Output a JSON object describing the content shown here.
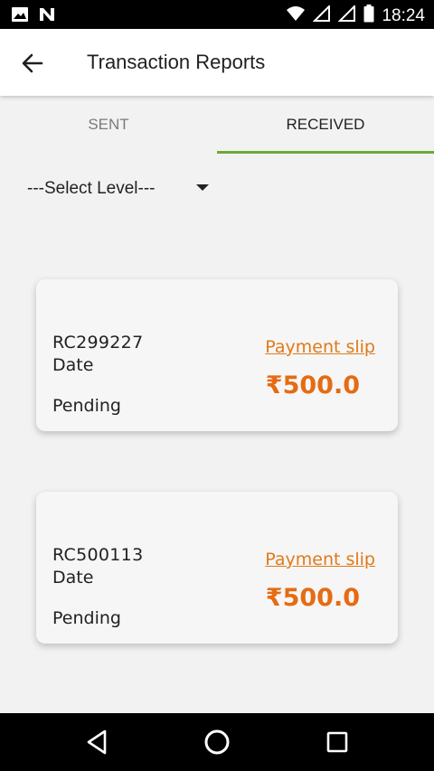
{
  "status_bar": {
    "time": "18:24",
    "icons": [
      "image-icon",
      "n-icon",
      "wifi-icon",
      "signal-icon",
      "signal-icon",
      "battery-icon"
    ]
  },
  "app_bar": {
    "title": "Transaction Reports",
    "back_icon": "arrow-left-icon"
  },
  "tabs": [
    {
      "label": "SENT",
      "active": false
    },
    {
      "label": "RECEIVED",
      "active": true
    }
  ],
  "filter": {
    "selected": "---Select Level---"
  },
  "transactions": [
    {
      "ref": "RC299227",
      "date_label": "Date",
      "status": "Pending",
      "slip_label": "Payment slip",
      "amount": "₹500.0"
    },
    {
      "ref": "RC500113",
      "date_label": "Date",
      "status": "Pending",
      "slip_label": "Payment slip",
      "amount": "₹500.0"
    }
  ],
  "colors": {
    "accent_green": "#6aaa35",
    "amount_orange": "#e66b12",
    "link_orange": "#e07a1a"
  },
  "nav_bar": {
    "icons": [
      "back-triangle-icon",
      "home-circle-icon",
      "recents-square-icon"
    ]
  }
}
